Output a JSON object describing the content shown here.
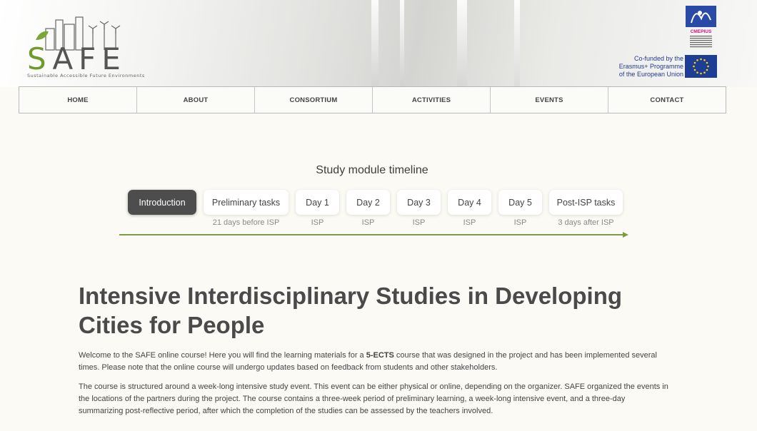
{
  "header": {
    "logo_text": "AFE",
    "logo_s": "S",
    "logo_tagline": "Sustainable   Accessible   Future   Environments",
    "erasmus_lines": [
      "Co-funded by the",
      "Erasmus+ Programme",
      "of the European Union"
    ],
    "cmepius_label": "CMEPIUS"
  },
  "nav": {
    "items": [
      "HOME",
      "ABOUT",
      "CONSORTIUM",
      "ACTIVITIES",
      "EVENTS",
      "CONTACT"
    ]
  },
  "timeline": {
    "title": "Study module timeline",
    "steps": [
      {
        "label": "Introduction",
        "sub": "",
        "active": true
      },
      {
        "label": "Preliminary tasks",
        "sub": "21 days before ISP"
      },
      {
        "label": "Day 1",
        "sub": "ISP"
      },
      {
        "label": "Day 2",
        "sub": "ISP"
      },
      {
        "label": "Day 3",
        "sub": "ISP"
      },
      {
        "label": "Day 4",
        "sub": "ISP"
      },
      {
        "label": "Day 5",
        "sub": "ISP"
      },
      {
        "label": "Post-ISP tasks",
        "sub": "3 days after ISP"
      }
    ]
  },
  "content": {
    "title": "Intensive Interdisciplinary Studies in Developing Cities for People",
    "para1_a": "Welcome to the SAFE online course! Here you will find the learning materials for a ",
    "para1_bold": "5-ECTS",
    "para1_b": " course that was designed in the project and has been implemented several times. Please note that the online course will undergo updates based on feedback from students and other stakeholders.",
    "para2": "The course is structured around a week-long intensive study event. This event can be either physical or online, depending on the organizer. SAFE organized the events in the locations of the partners during the project. The course contains a three-week period of preliminary learning, a week-long intensive event, and a three-day summarizing post-reflective period, after which the completion of the studies can be assessed by the teachers involved."
  },
  "colors": {
    "accent_green": "#7d9b43",
    "active_step": "#4d4d4d",
    "eu_blue": "#1e3e96"
  }
}
